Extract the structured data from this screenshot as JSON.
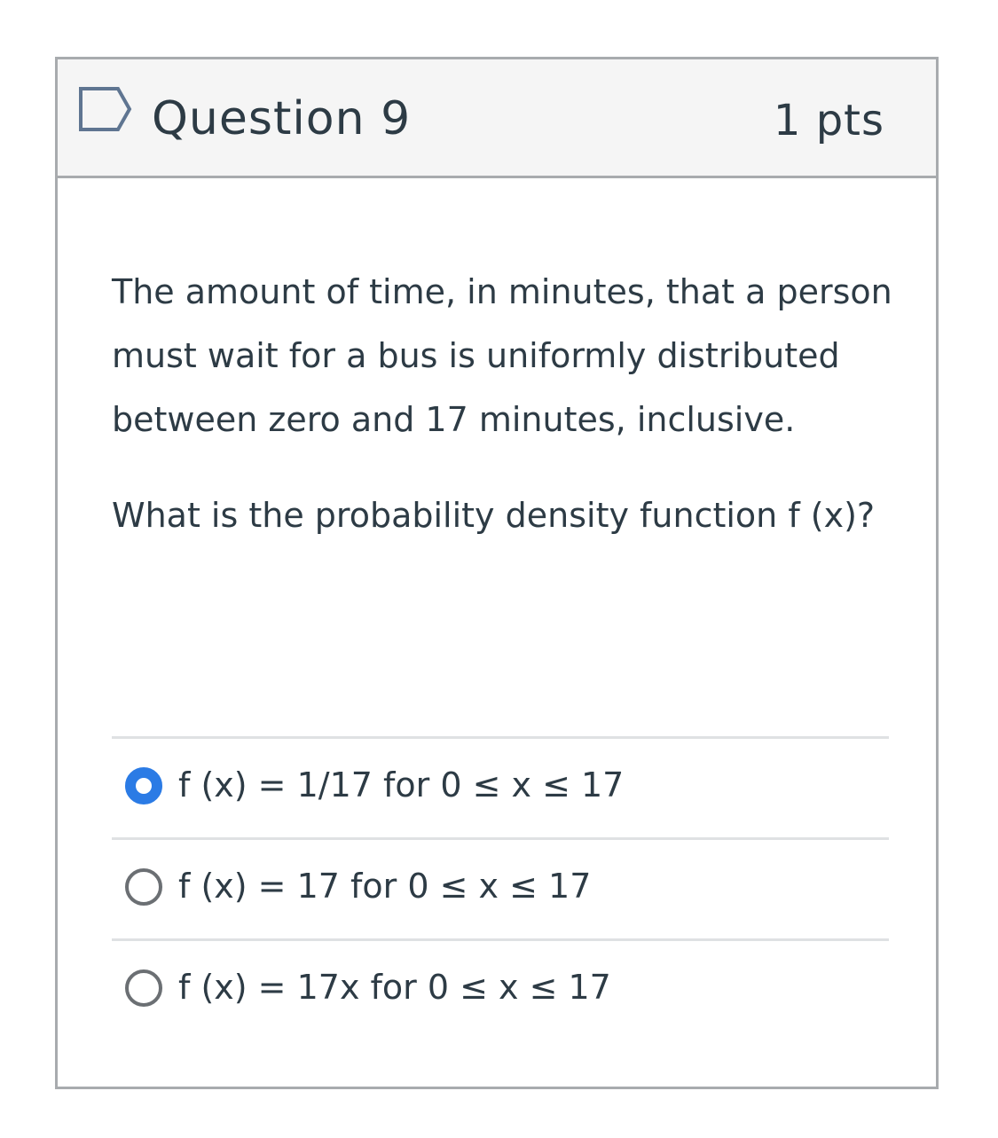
{
  "question": {
    "title": "Question 9",
    "points": "1 pts",
    "flag_icon": "flag-outline-icon",
    "paragraphs": [
      "The amount of time, in minutes, that a person must wait for a bus is uniformly distributed between zero and 17 minutes, inclusive.",
      "What is the probability density function f (x)?"
    ],
    "answers": [
      {
        "label": "f (x) = 1/17 for 0 ≤ x ≤ 17",
        "selected": true
      },
      {
        "label": "f (x) = 17 for 0 ≤ x ≤ 17",
        "selected": false
      },
      {
        "label": "f (x) = 17x for 0 ≤ x ≤ 17",
        "selected": false
      }
    ]
  },
  "colors": {
    "header_bg": "#f5f5f5",
    "border": "#a8abae",
    "text": "#2d3b45",
    "radio_selected": "#2b7be5",
    "radio_unselected": "#6b6f73",
    "divider": "#dfe1e3"
  }
}
